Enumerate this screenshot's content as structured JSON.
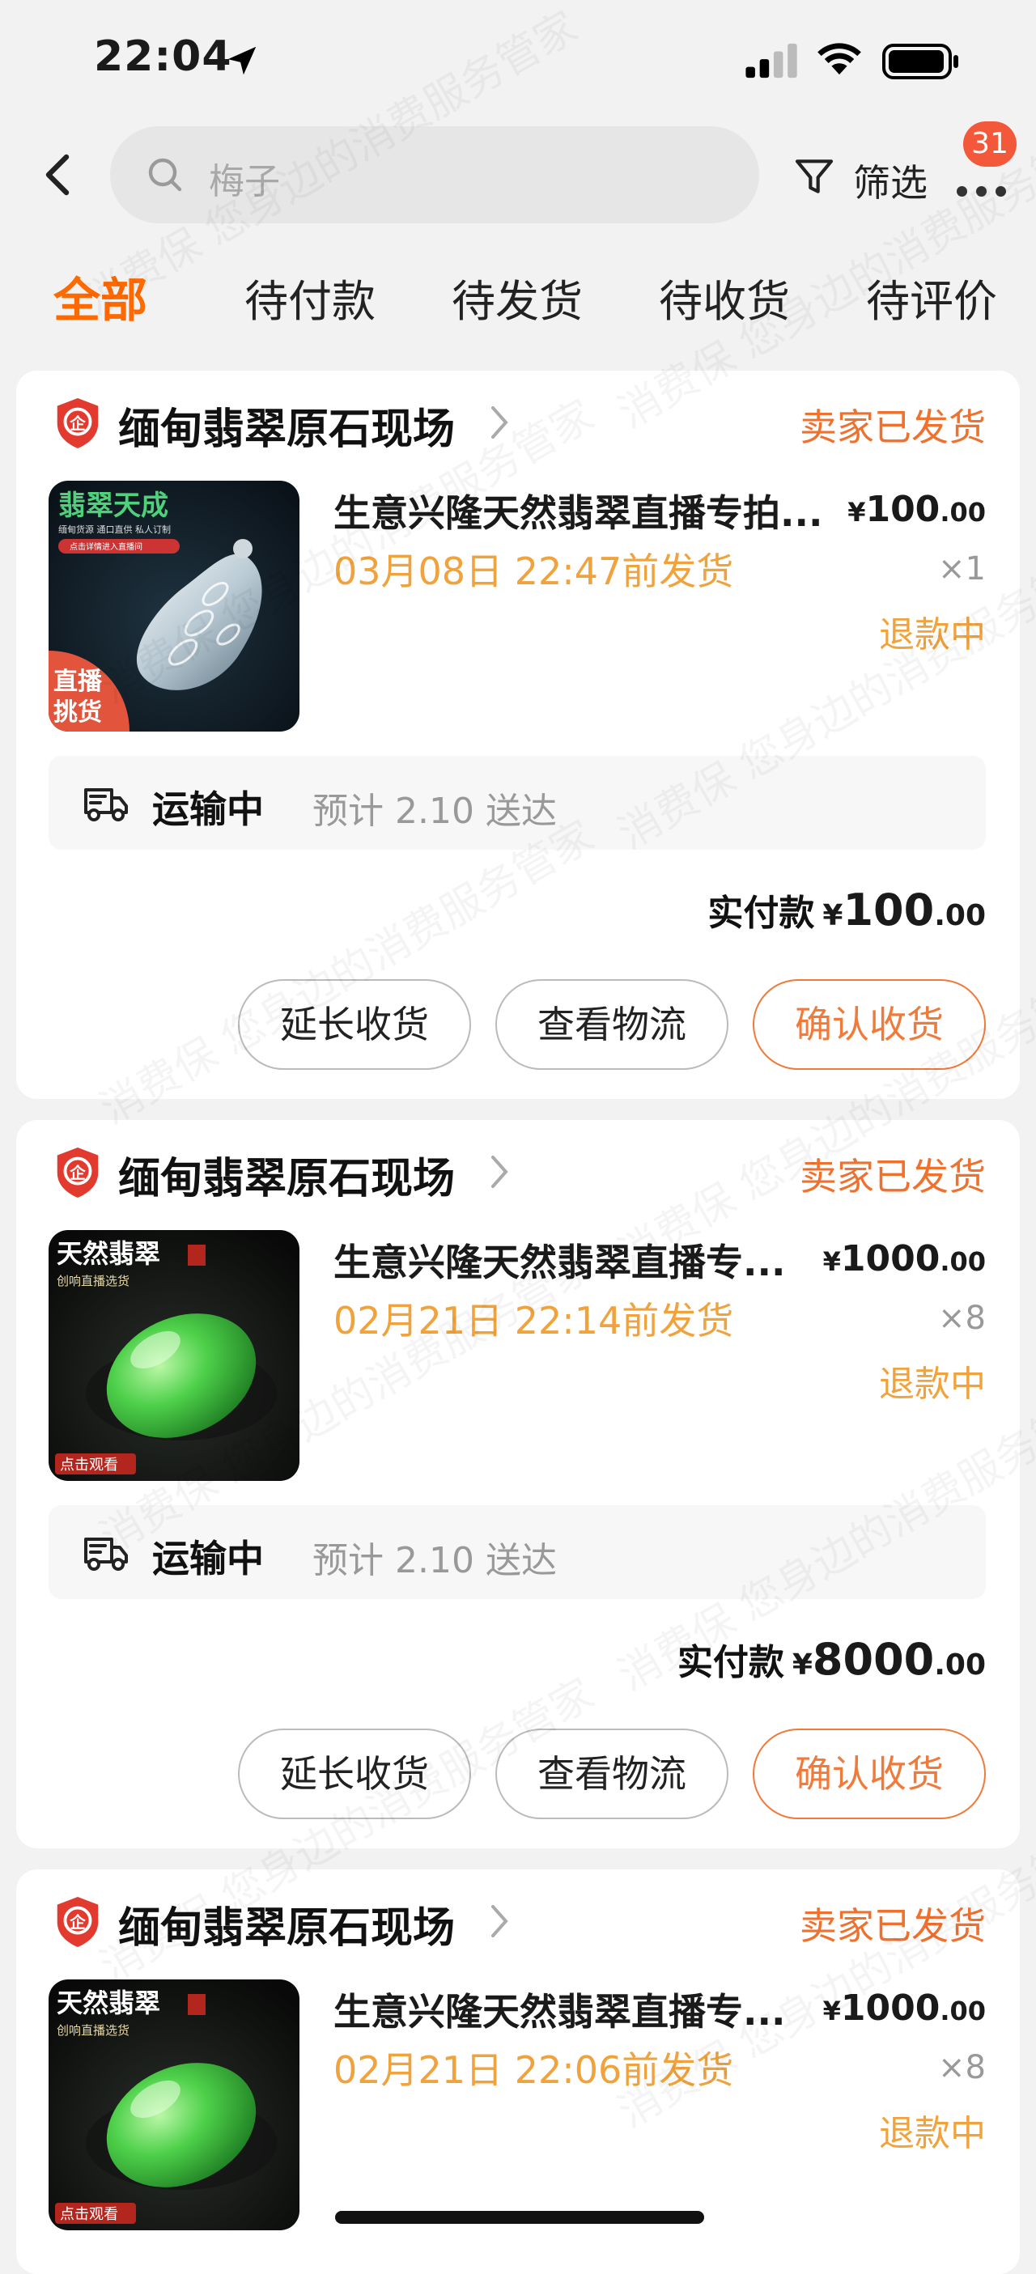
{
  "status_bar": {
    "time": "22:04"
  },
  "search": {
    "placeholder": "梅子"
  },
  "nav": {
    "filter_label": "筛选",
    "badge_count": "31"
  },
  "tabs": [
    {
      "label": "全部",
      "active": true
    },
    {
      "label": "待付款"
    },
    {
      "label": "待发货"
    },
    {
      "label": "待收货"
    },
    {
      "label": "待评价"
    }
  ],
  "colors": {
    "accent": "#ff6a00",
    "status_orange": "#f0702e",
    "deadline_gold": "#f0a23c",
    "badge_red": "#f4583a"
  },
  "orders": [
    {
      "shop_name": "缅甸翡翠原石现场",
      "status": "卖家已发货",
      "thumb_text_top": "翡翠天成",
      "thumb_text_sub": "缅甸货源 通口直供 私人订制",
      "thumb_text_btn": "点击详情进入直播间",
      "thumb_text_corner": "直播挑货",
      "title": "生意兴隆天然翡翠直播专拍...",
      "deadline": "03月08日 22:47前发货",
      "price_symbol": "¥",
      "price_int": "100",
      "price_dec": ".00",
      "qty": "×1",
      "refund_status": "退款中",
      "ship_status": "运输中",
      "ship_eta": "预计 2.10 送达",
      "paid_label": "实付款",
      "paid_symbol": "¥",
      "paid_int": "100",
      "paid_dec": ".00",
      "buttons": [
        "延长收货",
        "查看物流",
        "确认收货"
      ]
    },
    {
      "shop_name": "缅甸翡翠原石现场",
      "status": "卖家已发货",
      "thumb_text_top": "天然翡翠",
      "thumb_text_sub": "创响直播选货",
      "thumb_text_corner": "点击观看",
      "title": "生意兴隆天然翡翠直播专...",
      "deadline": "02月21日 22:14前发货",
      "price_symbol": "¥",
      "price_int": "1000",
      "price_dec": ".00",
      "qty": "×8",
      "refund_status": "退款中",
      "ship_status": "运输中",
      "ship_eta": "预计 2.10 送达",
      "paid_label": "实付款",
      "paid_symbol": "¥",
      "paid_int": "8000",
      "paid_dec": ".00",
      "buttons": [
        "延长收货",
        "查看物流",
        "确认收货"
      ]
    },
    {
      "shop_name": "缅甸翡翠原石现场",
      "status": "卖家已发货",
      "thumb_text_top": "天然翡翠",
      "thumb_text_sub": "创响直播选货",
      "thumb_text_corner": "点击观看",
      "title": "生意兴隆天然翡翠直播专...",
      "deadline": "02月21日 22:06前发货",
      "price_symbol": "¥",
      "price_int": "1000",
      "price_dec": ".00",
      "qty": "×8",
      "refund_status": "退款中"
    }
  ],
  "watermark_phrases": [
    "消费保",
    "您身边的消费服务管家"
  ]
}
